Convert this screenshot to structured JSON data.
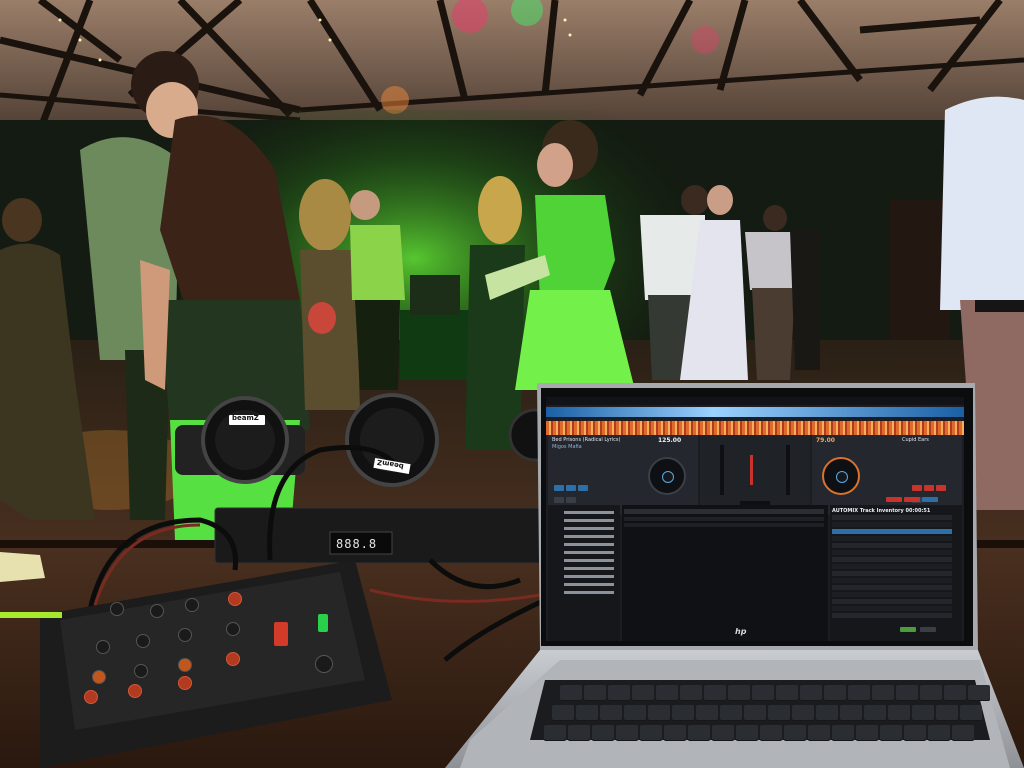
{
  "scene": {
    "description_colors": {
      "ceiling": "#6b5446",
      "wall": "#1a2415",
      "green_light": "#63ff3c",
      "table": "#3a2417",
      "laptop_body": "#b9bcc0",
      "mixer_body": "#1f1f1f"
    }
  },
  "light_fixtures": {
    "brand_left": "beamZ",
    "brand_right": "beamZ"
  },
  "controller": {
    "display": "888.8"
  },
  "laptop": {
    "brand_logo": "hp",
    "software": {
      "deck_left": {
        "title": "Bed Prisons (Radical Lyrics)",
        "artist": "Migos Mafia",
        "bpm": "125.00"
      },
      "deck_right": {
        "bpm": "79.00",
        "title": "Cupid Ears"
      },
      "automix_header": "AUTOMIX  Track Inventory  00:00:51"
    }
  }
}
